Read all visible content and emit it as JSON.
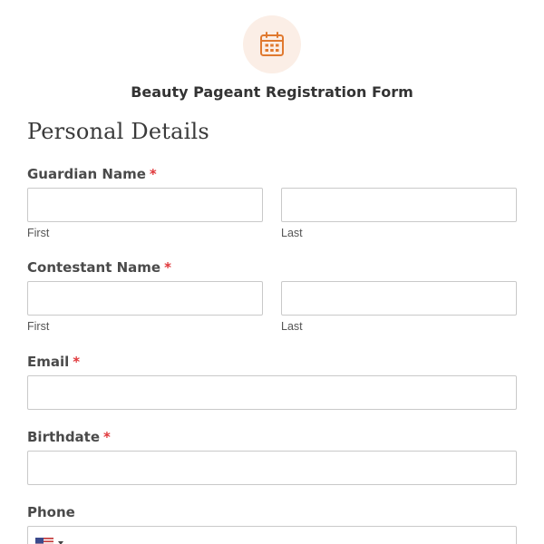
{
  "header": {
    "icon": "calendar-icon",
    "badge_color": "#fbeee6",
    "icon_color": "#e0792f",
    "title": "Beauty Pageant Registration Form"
  },
  "section": {
    "title": "Personal Details"
  },
  "required_marker": "*",
  "fields": {
    "guardian_name": {
      "label": "Guardian Name",
      "first_value": "",
      "last_value": "",
      "first_sublabel": "First",
      "last_sublabel": "Last"
    },
    "contestant_name": {
      "label": "Contestant Name",
      "first_value": "",
      "last_value": "",
      "first_sublabel": "First",
      "last_sublabel": "Last"
    },
    "email": {
      "label": "Email",
      "value": ""
    },
    "birthdate": {
      "label": "Birthdate",
      "value": ""
    },
    "phone": {
      "label": "Phone",
      "country_flag": "us-flag-icon",
      "value": ""
    }
  },
  "colors": {
    "required": "#e0373a",
    "border": "#c9c9c9",
    "label_text": "#4a4a4a"
  }
}
